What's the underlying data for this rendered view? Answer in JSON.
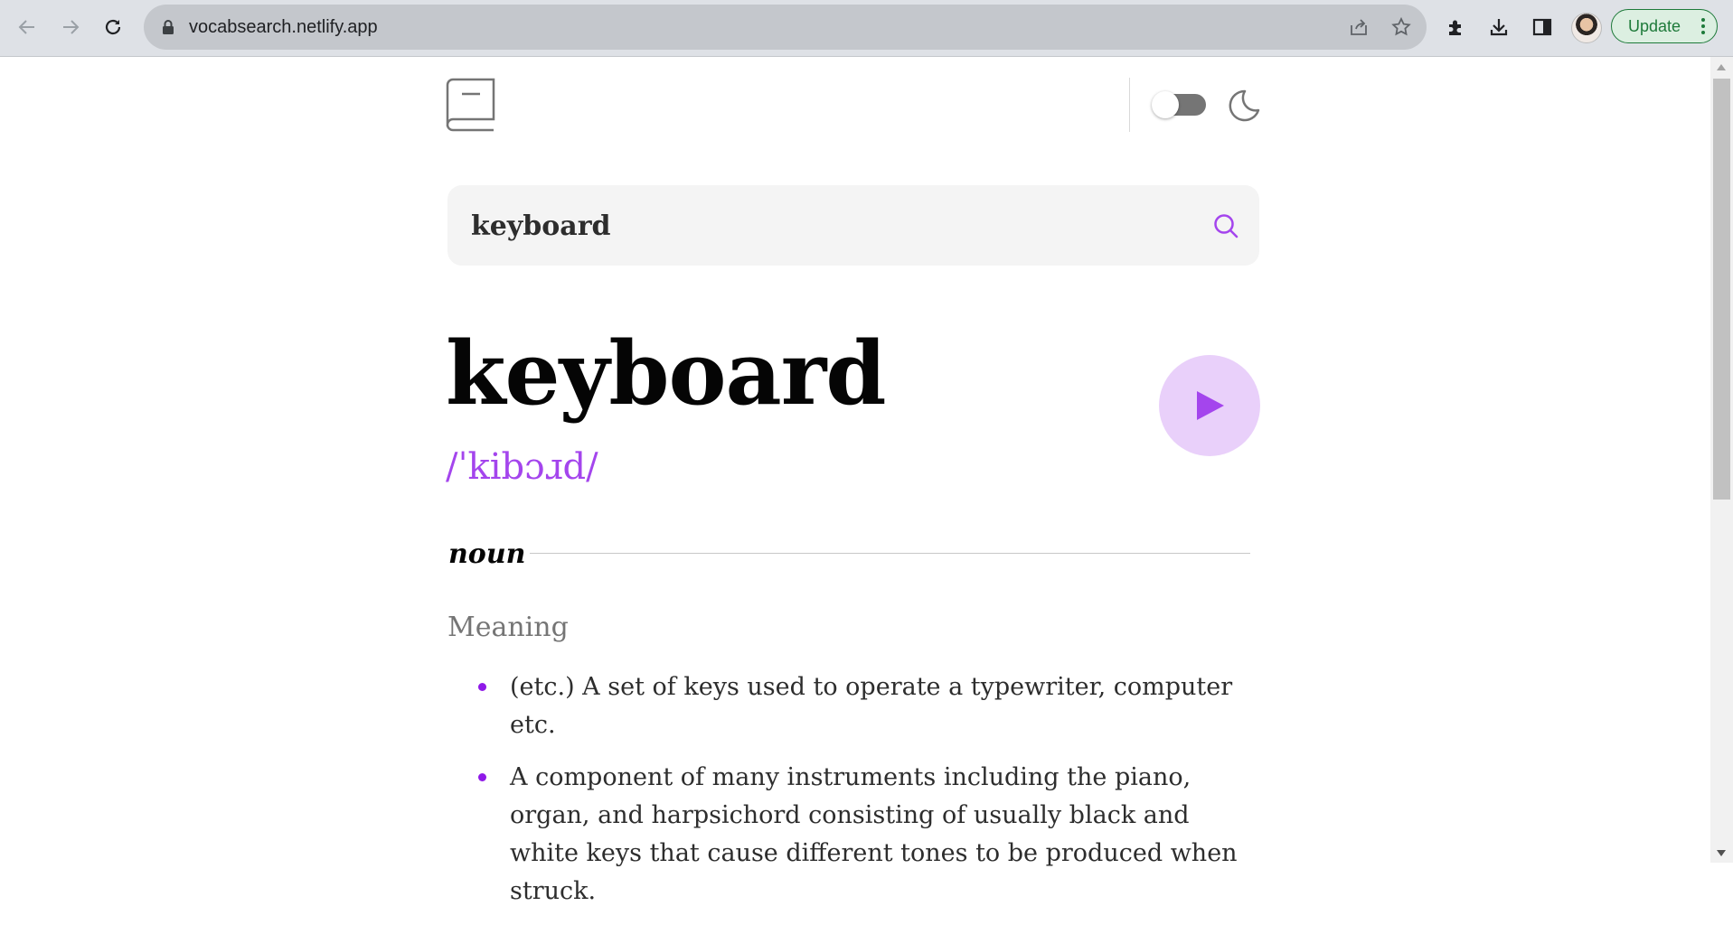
{
  "browser": {
    "url": "vocabsearch.netlify.app",
    "update_label": "Update",
    "icons": {
      "back": "arrow-left-icon",
      "forward": "arrow-right-icon",
      "reload": "reload-icon",
      "lock": "lock-icon",
      "share": "share-icon",
      "bookmark": "star-icon",
      "extensions": "puzzle-icon",
      "downloads": "download-icon",
      "side_panel": "side-panel-icon",
      "menu": "more-vert-icon"
    }
  },
  "header": {
    "logo_icon": "book-icon",
    "theme_toggle_on": false,
    "theme_icon": "moon-icon"
  },
  "search": {
    "value": "keyboard",
    "icon": "search-icon"
  },
  "entry": {
    "word": "keyboard",
    "phonetic": "/ˈkibɔɹd/",
    "play_icon": "play-icon"
  },
  "meanings": [
    {
      "part_of_speech": "noun",
      "heading": "Meaning",
      "definitions": [
        "(etc.) A set of keys used to operate a typewriter, computer etc.",
        "A component of many instruments including the piano, organ, and harpsichord consisting of usually black and white keys that cause different tones to be produced when struck."
      ]
    }
  ],
  "colors": {
    "accent": "#a445ed",
    "accent_light": "#e9d0fa",
    "text": "#2d2d2d",
    "muted": "#757575",
    "search_bg": "#f4f4f4",
    "update_green": "#1e7a3a"
  }
}
